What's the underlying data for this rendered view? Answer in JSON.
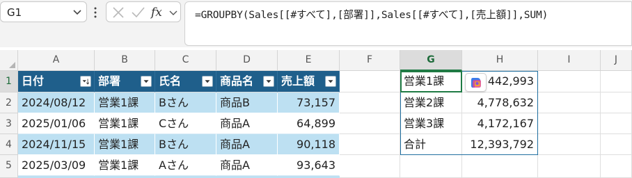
{
  "name_box": {
    "value": "G1"
  },
  "formula_bar": {
    "formula": "=GROUPBY(Sales[[#すべて],[部署]],Sales[[#すべて],[売上額]],SUM)"
  },
  "columns": [
    "A",
    "B",
    "C",
    "D",
    "E",
    "F",
    "G",
    "H",
    "I",
    "J"
  ],
  "selected_column": "G",
  "rows": [
    "1",
    "2",
    "3",
    "4",
    "5"
  ],
  "table": {
    "headers": [
      "日付",
      "部署",
      "氏名",
      "商品名",
      "売上額"
    ],
    "rows": [
      [
        "2024/08/12",
        "営業1課",
        "Bさん",
        "商品B",
        "73,157"
      ],
      [
        "2025/01/06",
        "営業1課",
        "Cさん",
        "商品A",
        "64,899"
      ],
      [
        "2024/11/15",
        "営業1課",
        "Bさん",
        "商品A",
        "90,118"
      ],
      [
        "2025/03/09",
        "営業1課",
        "Aさん",
        "商品A",
        "93,643"
      ]
    ],
    "header_color": "#1f5f8b",
    "band_color": "#bde0f2"
  },
  "groupby_result": [
    {
      "dept": "営業1課",
      "total": "442,993"
    },
    {
      "dept": "営業2課",
      "total": "4,778,632"
    },
    {
      "dept": "営業3課",
      "total": "4,172,167"
    },
    {
      "dept": "合計",
      "total": "12,393,792"
    }
  ],
  "icons": {
    "name_box_dropdown": "chevron-down-icon",
    "more": "vertical-ellipsis-icon",
    "cancel": "cancel-x-icon",
    "enter": "checkmark-icon",
    "function": "fx-icon",
    "copilot": "copilot-icon"
  },
  "accent_color": "#1f7a44"
}
